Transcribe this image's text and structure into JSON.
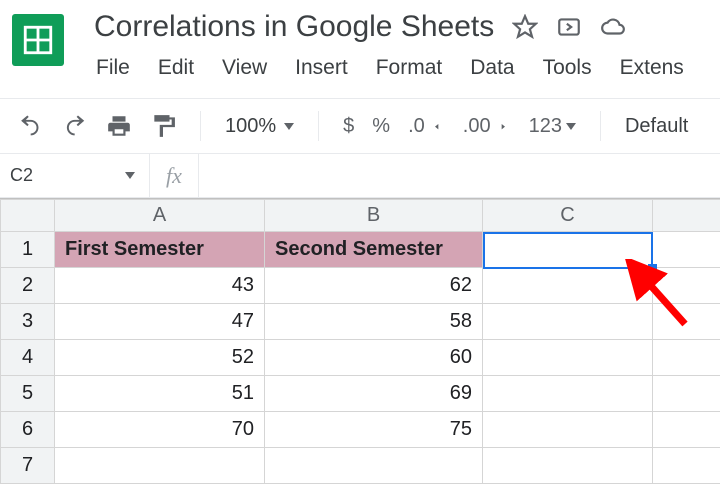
{
  "app": {
    "doc_title": "Correlations in Google Sheets"
  },
  "menu": {
    "file": "File",
    "edit": "Edit",
    "view": "View",
    "insert": "Insert",
    "format": "Format",
    "data": "Data",
    "tools": "Tools",
    "extensions": "Extens"
  },
  "toolbar": {
    "zoom": "100%",
    "currency": "$",
    "percent": "%",
    "dec_dec": ".0",
    "inc_dec": ".00",
    "num_fmt": "123",
    "font": "Default"
  },
  "namebox": {
    "value": "C2",
    "fx_label": "fx",
    "formula": ""
  },
  "columns": {
    "a": "A",
    "b": "B",
    "c": "C"
  },
  "rows": {
    "r1": "1",
    "r2": "2",
    "r3": "3",
    "r4": "4",
    "r5": "5",
    "r6": "6",
    "r7": "7"
  },
  "cells": {
    "a1": "First Semester",
    "b1": "Second Semester",
    "a2": "43",
    "b2": "62",
    "a3": "47",
    "b3": "58",
    "a4": "52",
    "b4": "60",
    "a5": "51",
    "b5": "69",
    "a6": "70",
    "b6": "75"
  },
  "chart_data": {
    "type": "table",
    "columns": [
      "First Semester",
      "Second Semester"
    ],
    "rows": [
      [
        43,
        62
      ],
      [
        47,
        58
      ],
      [
        52,
        60
      ],
      [
        51,
        69
      ],
      [
        70,
        75
      ]
    ]
  }
}
